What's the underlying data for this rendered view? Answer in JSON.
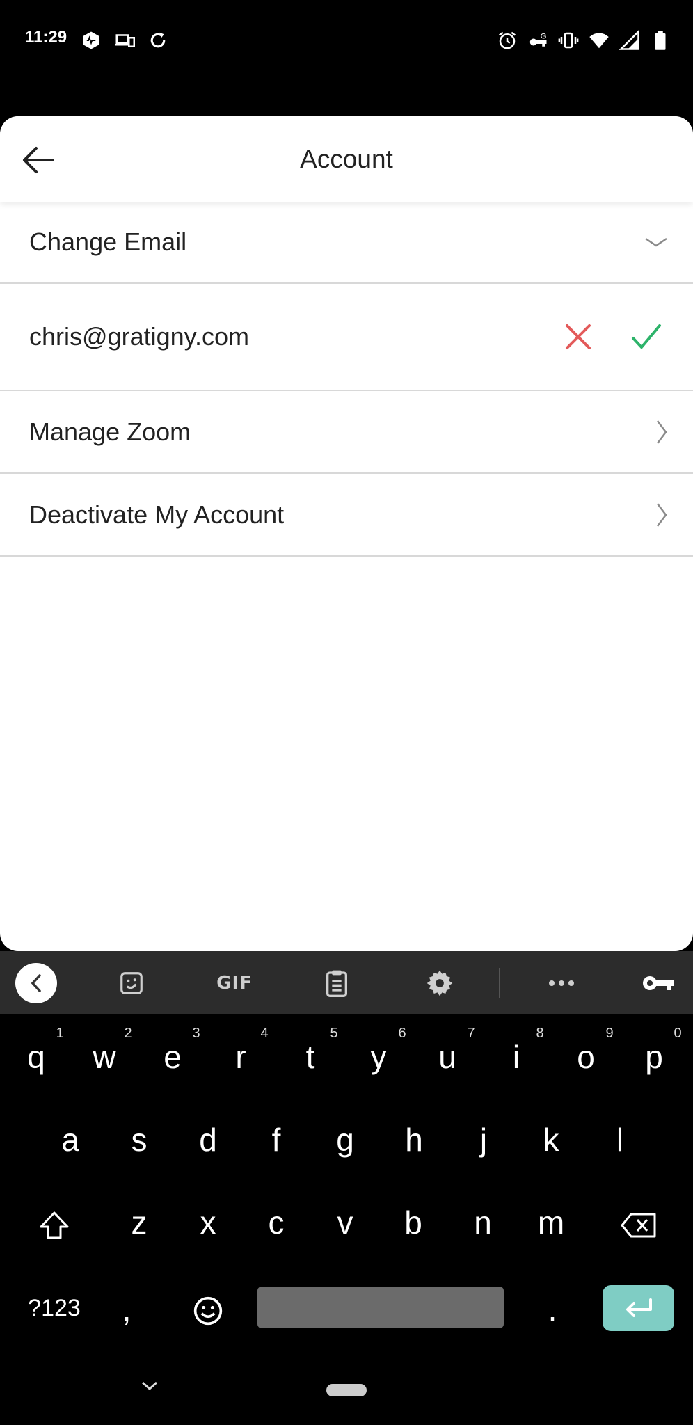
{
  "status_bar": {
    "time": "11:29",
    "left_icons": [
      "hexagon-app-icon",
      "devices-icon",
      "sync-icon"
    ],
    "right_icons": [
      "alarm-icon",
      "vpn-key-icon",
      "vibrate-icon",
      "wifi-icon",
      "signal-icon",
      "battery-icon"
    ]
  },
  "header": {
    "title": "Account",
    "back_icon": "arrow-left-icon"
  },
  "rows": {
    "change_email": {
      "label": "Change Email",
      "icon": "chevron-down-icon"
    },
    "email_edit": {
      "value": "chris@gratigny.com",
      "cancel_color": "#e35a5a",
      "confirm_color": "#2db36a"
    },
    "manage_zoom": {
      "label": "Manage Zoom",
      "icon": "chevron-right-icon"
    },
    "deactivate": {
      "label": "Deactivate My Account",
      "icon": "chevron-right-icon"
    }
  },
  "keyboard": {
    "toolbar": [
      "back-icon",
      "sticker-icon",
      "GIF",
      "clipboard-icon",
      "settings-icon",
      "more-icon",
      "key-icon"
    ],
    "gif_label": "GIF",
    "row1": [
      "q",
      "w",
      "e",
      "r",
      "t",
      "y",
      "u",
      "i",
      "o",
      "p"
    ],
    "row1_hints": [
      "1",
      "2",
      "3",
      "4",
      "5",
      "6",
      "7",
      "8",
      "9",
      "0"
    ],
    "row2": [
      "a",
      "s",
      "d",
      "f",
      "g",
      "h",
      "j",
      "k",
      "l"
    ],
    "row3": [
      "z",
      "x",
      "c",
      "v",
      "b",
      "n",
      "m"
    ],
    "symbols_key": "?123",
    "comma_key": ",",
    "period_key": ".",
    "enter_color": "#7fcdc4"
  }
}
